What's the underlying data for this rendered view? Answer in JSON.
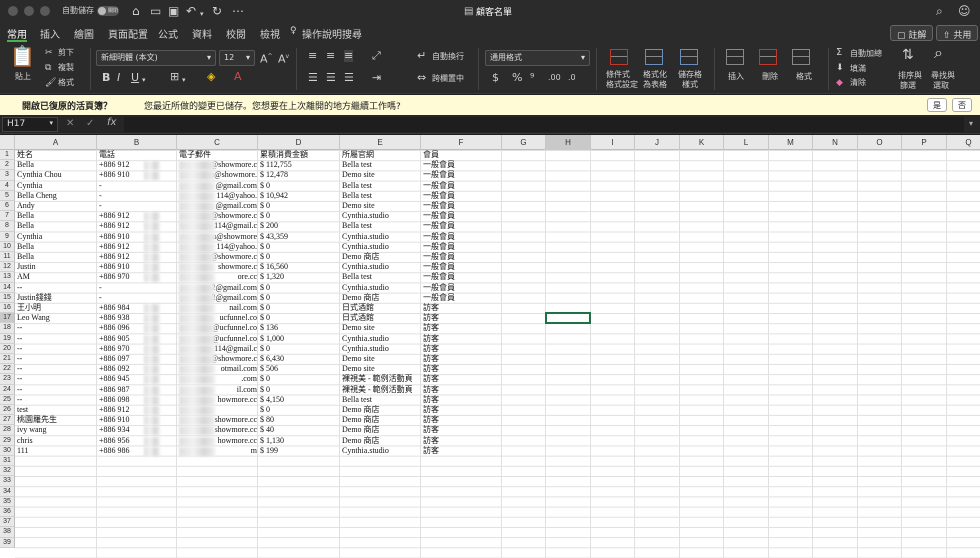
{
  "titlebar": {
    "autosave_label": "自動儲存",
    "autosave_state": "關閉",
    "doc_title": "顧客名單"
  },
  "tabs": [
    "常用",
    "插入",
    "繪圖",
    "頁面配置",
    "公式",
    "資料",
    "校閱",
    "檢視",
    "操作說明搜尋"
  ],
  "top_buttons": {
    "comment": "註解",
    "share": "共用"
  },
  "ribbon": {
    "paste": "貼上",
    "cut": "剪下",
    "copy": "複製",
    "format_painter": "格式",
    "font_name": "新細明體 (本文)",
    "font_size": "12",
    "wrap_text": "自動換行",
    "merge_center": "跨欄置中",
    "number_format": "通用格式",
    "conditional_formatting": [
      "條件式",
      "格式設定"
    ],
    "format_as_table": [
      "格式化",
      "為表格"
    ],
    "cell_styles": [
      "儲存格",
      "樣式"
    ],
    "insert": "插入",
    "delete": "刪除",
    "format": "格式",
    "autosum": "自動加總",
    "fill": "填滿",
    "clear": "清除",
    "sort_filter": [
      "排序與",
      "篩選"
    ],
    "find_select": [
      "尋找與",
      "選取"
    ]
  },
  "infobar": {
    "title": "開啟已復原的活頁簿？",
    "message": "您最近所做的變更已儲存。您想要在上次離開的地方繼續工作嗎?",
    "yes": "是",
    "no": "否"
  },
  "formula_bar": {
    "name_box": "H17",
    "fx": "fx",
    "formula": ""
  },
  "selected_cell": "H17",
  "columns": [
    "A",
    "B",
    "C",
    "D",
    "E",
    "F",
    "G",
    "H",
    "I",
    "J",
    "K",
    "L",
    "M",
    "N",
    "O",
    "P",
    "Q"
  ],
  "row_count": 39,
  "headers": [
    "姓名",
    "電話",
    "電子郵件",
    "累積消費金額",
    "所屬官網",
    "會員"
  ],
  "rows": [
    [
      "Bella",
      "+886 912",
      "@showmore.c",
      "$ 112,755",
      "Bella test",
      "一般會員"
    ],
    [
      "Cynthia Chou",
      "+886 910",
      "u@showmore.",
      "$ 12,478",
      "Demo site",
      "一般會員"
    ],
    [
      "Cynthia",
      "-",
      "@gmail.com",
      "$ 0",
      "Bella test",
      "一般會員"
    ],
    [
      "Bella Cheng",
      "-",
      "114@yahoo.",
      "$ 10,942",
      "Bella test",
      "一般會員"
    ],
    [
      "Andy",
      "-",
      "@gmail.com",
      "$ 0",
      "Demo site",
      "一般會員"
    ],
    [
      "Bella",
      "+886 912",
      "@showmore.c",
      "$ 0",
      "Cynthia.studio",
      "一般會員"
    ],
    [
      "Bella",
      "+886 912",
      "114@gmail.c",
      "$ 200",
      "Bella test",
      "一般會員"
    ],
    [
      "Cynthia",
      "+886 910",
      "u@showmore",
      "$ 43,359",
      "Cynthia.studio",
      "一般會員"
    ],
    [
      "Bella",
      "+886 912",
      "114@yahoo.",
      "$ 0",
      "Cynthia.studio",
      "一般會員"
    ],
    [
      "Bella",
      "+886 912",
      "@showmore.c",
      "$ 0",
      "Demo 商店",
      "一般會員"
    ],
    [
      "Justin",
      "+886 910",
      "showmore.c",
      "$ 16,560",
      "Cynthia.studio",
      "一般會員"
    ],
    [
      "AM",
      "+886 970",
      "ore.cc",
      "$ 1,320",
      "Bella test",
      "一般會員"
    ],
    [
      "--",
      "-",
      "2@gmail.com",
      "$ 0",
      "Cynthia.studio",
      "一般會員"
    ],
    [
      "Justin錢錢",
      "-",
      "2@gmail.com",
      "$ 0",
      "Demo 商店",
      "一般會員"
    ],
    [
      "王小明",
      "+886 984",
      "nail.com",
      "$ 0",
      "日式酒館",
      "訪客"
    ],
    [
      "Leo Wang",
      "+886 938",
      "ucfunnel.co",
      "$ 0",
      "日式酒館",
      "訪客"
    ],
    [
      "--",
      "+886 096",
      "@ucfunnel.co",
      "$ 136",
      "Demo site",
      "訪客"
    ],
    [
      "--",
      "+886 905",
      "@ucfunnel.co",
      "$ 1,000",
      "Cynthia.studio",
      "訪客"
    ],
    [
      "--",
      "+886 970",
      "114@gmail.c",
      "$ 0",
      "Cynthia.studio",
      "訪客"
    ],
    [
      "--",
      "+886 097",
      "@showmore.c",
      "$ 6,430",
      "Demo site",
      "訪客"
    ],
    [
      "--",
      "+886 092",
      "otmail.com",
      "$ 506",
      "Demo site",
      "訪客"
    ],
    [
      "--",
      "+886 945",
      ".com",
      "$ 0",
      "裸視美 - 範例活動頁",
      "訪客"
    ],
    [
      "--",
      "+886 987",
      "il.com",
      "$ 0",
      "裸視美 - 範例活動頁",
      "訪客"
    ],
    [
      "--",
      "+886 098",
      "howmore.cc",
      "$ 4,150",
      "Bella test",
      "訪客"
    ],
    [
      "test",
      "+886 912",
      "",
      "$ 0",
      "Demo 商店",
      "訪客"
    ],
    [
      "桃園羅先生",
      "+886 910",
      "showmore.cc",
      "$ 80",
      "Demo 商店",
      "訪客"
    ],
    [
      "ivy wang",
      "+886 934",
      "showmore.cc",
      "$ 40",
      "Demo 商店",
      "訪客"
    ],
    [
      "chris",
      "+886 956",
      "howmore.cc",
      "$ 1,130",
      "Demo 商店",
      "訪客"
    ],
    [
      "111",
      "+886 986",
      "m",
      "$ 199",
      "Cynthia.studio",
      "訪客"
    ]
  ]
}
